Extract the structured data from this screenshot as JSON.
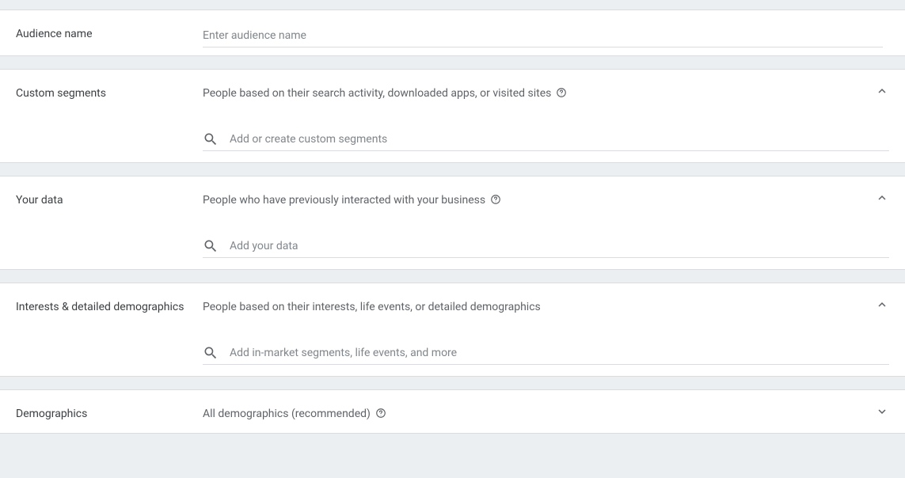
{
  "audience": {
    "label": "Audience name",
    "placeholder": "Enter audience name"
  },
  "customSegments": {
    "label": "Custom segments",
    "description": "People based on their search activity, downloaded apps, or visited sites",
    "searchPlaceholder": "Add or create custom segments"
  },
  "yourData": {
    "label": "Your data",
    "description": "People who have previously interacted with your business",
    "searchPlaceholder": "Add your data"
  },
  "interests": {
    "label": "Interests & detailed demographics",
    "description": "People based on their interests, life events, or detailed demographics",
    "searchPlaceholder": "Add in-market segments, life events, and more"
  },
  "demographics": {
    "label": "Demographics",
    "description": "All demographics (recommended)"
  }
}
